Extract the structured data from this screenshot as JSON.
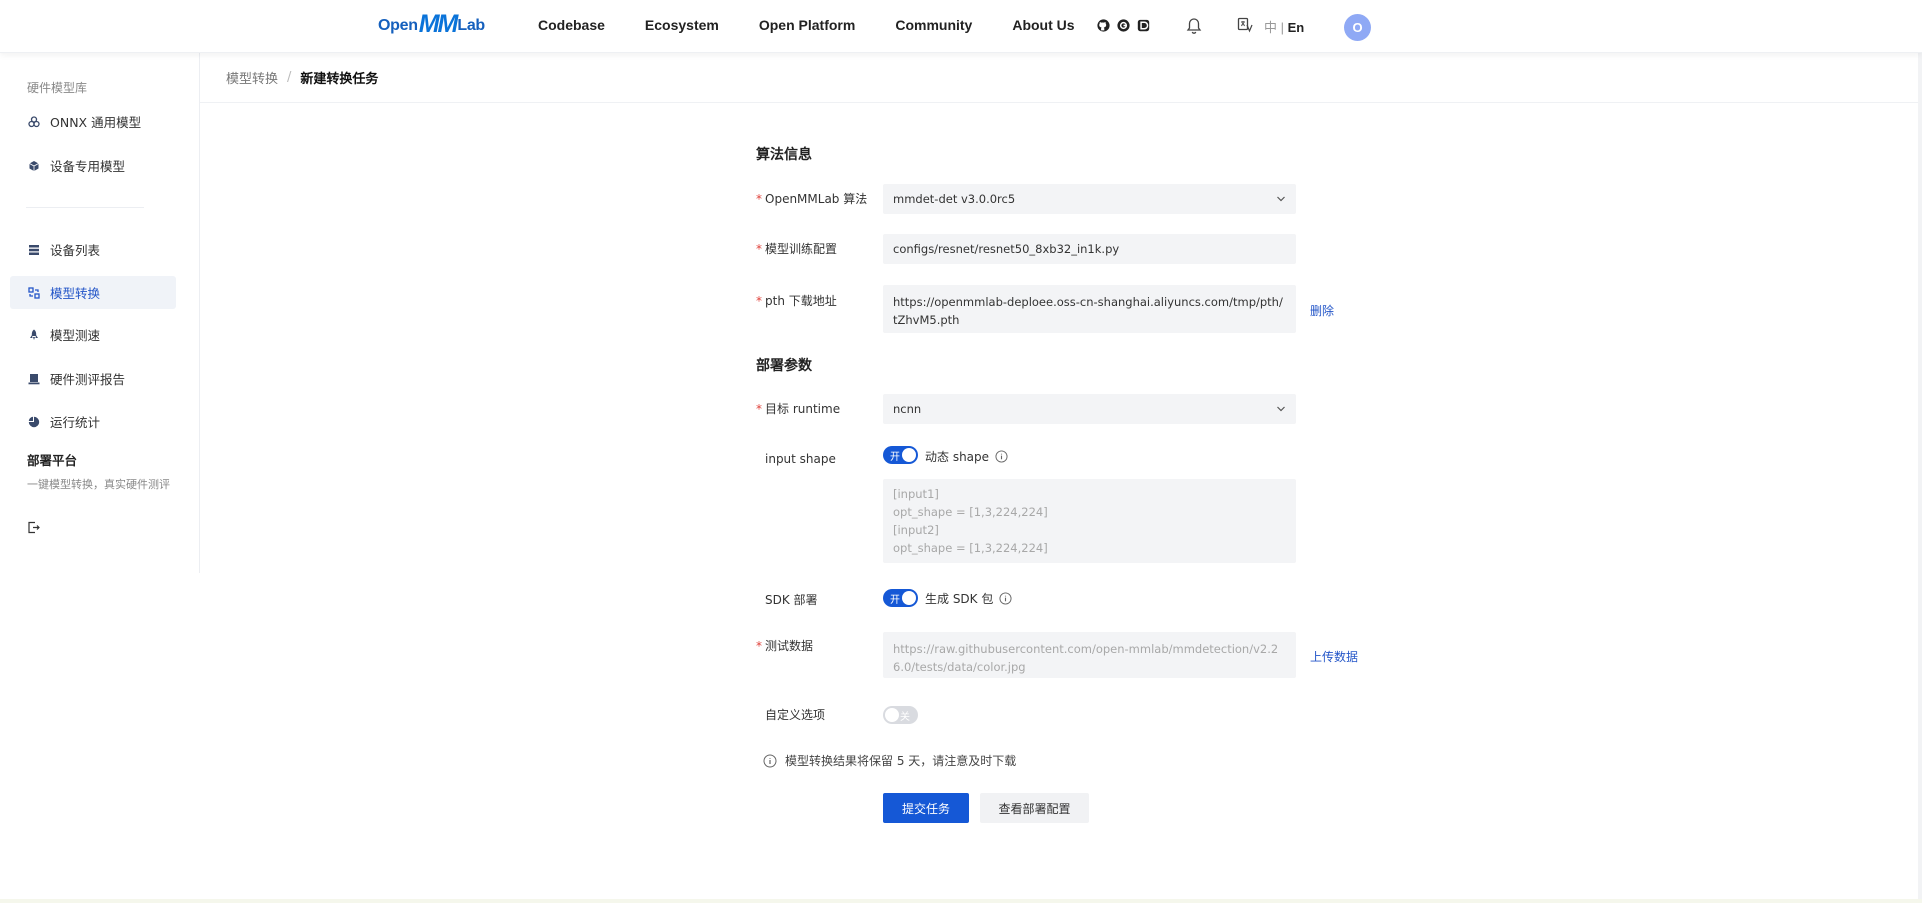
{
  "topnav": {
    "logo": {
      "part1": "Open",
      "part2": "MM",
      "part3": "Lab"
    },
    "links": [
      "Codebase",
      "Ecosystem",
      "Open Platform",
      "Community",
      "About Us"
    ],
    "icons": [
      "github-icon",
      "opencompass-icon",
      "discord-icon"
    ],
    "lang_zh": "中",
    "lang_sep": " | ",
    "lang_en": "En",
    "avatar_initial": "O"
  },
  "sidebar": {
    "group_title": "硬件模型库",
    "model_items": [
      {
        "label": "ONNX 通用模型",
        "icon": "onnx-icon"
      },
      {
        "label": "设备专用模型",
        "icon": "cube-icon"
      }
    ],
    "tool_items": [
      {
        "label": "设备列表",
        "icon": "list-icon"
      },
      {
        "label": "模型转换",
        "icon": "convert-icon",
        "active": true
      },
      {
        "label": "模型测速",
        "icon": "rocket-icon"
      },
      {
        "label": "硬件测评报告",
        "icon": "report-icon"
      },
      {
        "label": "运行统计",
        "icon": "pie-chart-icon"
      }
    ],
    "brand": "部署平台",
    "brand_sub": "一键模型转换，真实硬件测评"
  },
  "breadcrumb": {
    "parent": "模型转换",
    "separator": "/",
    "current": "新建转换任务"
  },
  "form": {
    "section_algo": "算法信息",
    "algo_label": "OpenMMLab 算法",
    "algo_value": "mmdet-det v3.0.0rc5",
    "config_label": "模型训练配置",
    "config_value": "configs/resnet/resnet50_8xb32_in1k.py",
    "pth_label": "pth 下载地址",
    "pth_value": "https://openmmlab-deploee.oss-cn-shanghai.aliyuncs.com/tmp/pth/tZhvM5.pth",
    "pth_delete": "删除",
    "section_deploy": "部署参数",
    "runtime_label": "目标 runtime",
    "runtime_value": "ncnn",
    "input_shape_label": "input shape",
    "input_shape_toggle": "开",
    "input_shape_toggle_label": "动态 shape",
    "input_shape_placeholder": [
      "[input1]",
      "opt_shape = [1,3,224,224]",
      "[input2]",
      "opt_shape = [1,3,224,224]"
    ],
    "sdk_label": "SDK 部署",
    "sdk_toggle": "开",
    "sdk_toggle_label": "生成 SDK 包",
    "test_data_label": "测试数据",
    "test_data_placeholder": "https://raw.githubusercontent.com/open-mmlab/mmdetection/v2.26.0/tests/data/color.jpg",
    "upload_link": "上传数据",
    "custom_label": "自定义选项",
    "custom_toggle": "关",
    "notice": "模型转换结果将保留 5 天，请注意及时下载",
    "submit": "提交任务",
    "view_config": "查看部署配置"
  },
  "colors": {
    "primary": "#1558d6",
    "link": "#2456c8",
    "required": "#e0413a",
    "field_bg": "#f3f4f6",
    "active_item_bg": "#f0f3f8"
  }
}
